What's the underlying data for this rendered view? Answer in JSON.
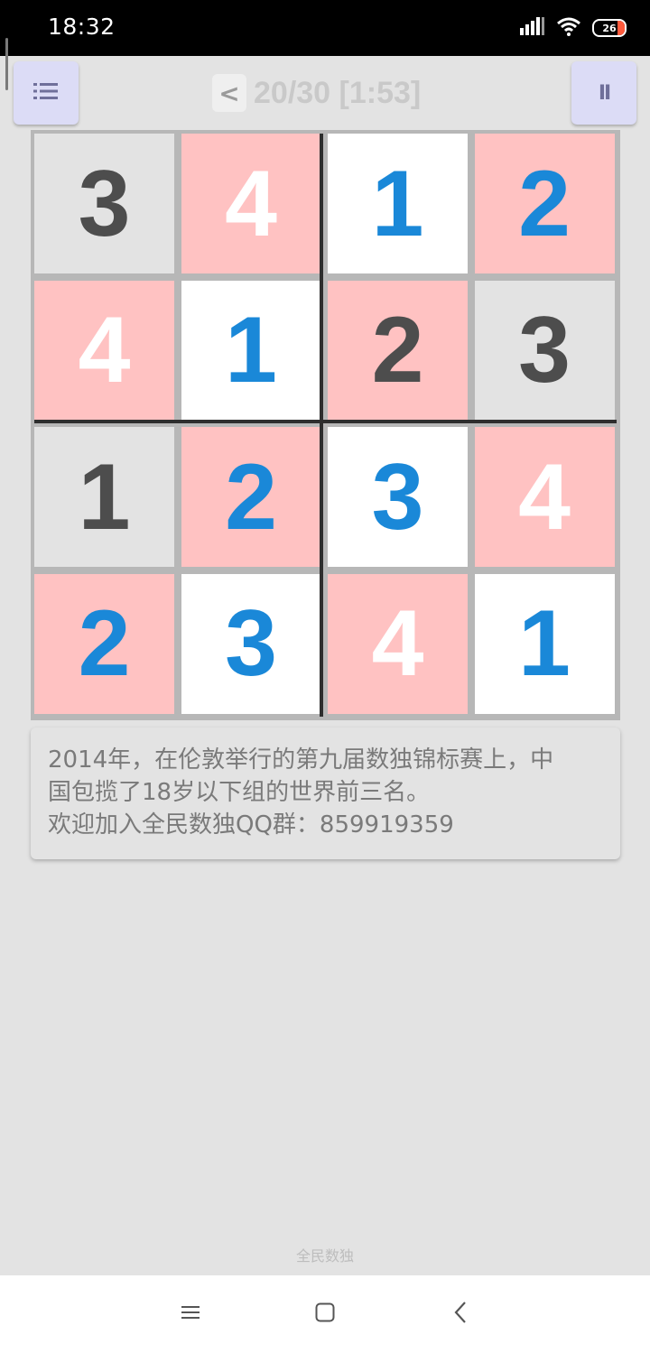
{
  "status_bar": {
    "time": "18:32",
    "battery_level": "26",
    "icons": [
      "signal-icon",
      "wifi-icon",
      "battery-icon"
    ]
  },
  "header": {
    "back_label": "<",
    "progress": "20/30",
    "timer": "[1:53]",
    "title": "20/30 [1:53]",
    "menu_icon": "list-icon",
    "pause_label": "II"
  },
  "board": {
    "size": 4,
    "cells": [
      [
        {
          "value": "3",
          "type": "given"
        },
        {
          "value": "4",
          "type": "error"
        },
        {
          "value": "1",
          "type": "entered"
        },
        {
          "value": "2",
          "type": "entered"
        }
      ],
      [
        {
          "value": "4",
          "type": "error"
        },
        {
          "value": "1",
          "type": "entered"
        },
        {
          "value": "2",
          "type": "given"
        },
        {
          "value": "3",
          "type": "given"
        }
      ],
      [
        {
          "value": "1",
          "type": "given"
        },
        {
          "value": "2",
          "type": "entered"
        },
        {
          "value": "3",
          "type": "entered"
        },
        {
          "value": "4",
          "type": "error"
        }
      ],
      [
        {
          "value": "2",
          "type": "entered"
        },
        {
          "value": "3",
          "type": "entered"
        },
        {
          "value": "4",
          "type": "error"
        },
        {
          "value": "1",
          "type": "entered"
        }
      ]
    ],
    "backgrounds": [
      [
        "gray",
        "pink",
        "white",
        "pink"
      ],
      [
        "pink",
        "white",
        "pink",
        "gray"
      ],
      [
        "gray",
        "pink",
        "white",
        "pink"
      ],
      [
        "pink",
        "white",
        "pink",
        "white"
      ]
    ],
    "colors": {
      "given_text": "#4d4d4d",
      "entered_text": "#1a88d8",
      "error_text": "#ffffff",
      "bg_gray": "#e3e3e3",
      "bg_pink": "#ffc2c2",
      "bg_white": "#ffffff"
    }
  },
  "fact": {
    "lines": [
      "2014年，在伦敦举行的第九届数独锦标赛上，中",
      "国包揽了18岁以下组的世界前三名。",
      "欢迎加入全民数独QQ群：859919359"
    ]
  },
  "footer": {
    "app_name": "全民数独"
  },
  "nav_bar": {
    "buttons": [
      "menu-lines-icon",
      "home-square-icon",
      "back-chevron-icon"
    ]
  }
}
